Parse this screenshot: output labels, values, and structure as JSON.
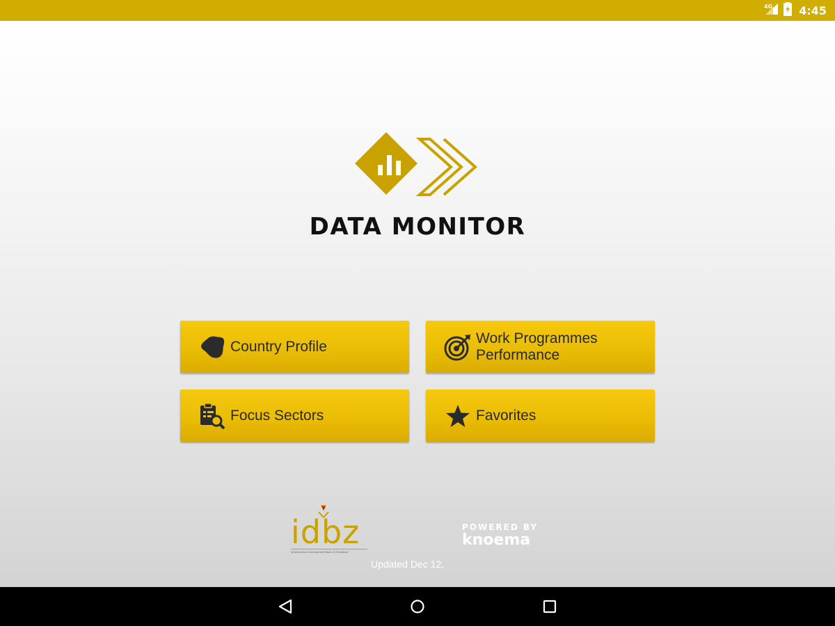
{
  "status_bar": {
    "network": "4G",
    "time": "4:45"
  },
  "app": {
    "title": "DATA MONITOR"
  },
  "menu": [
    {
      "label": "Country Profile",
      "icon": "zimbabwe-map-icon"
    },
    {
      "label": "Work Programmes Performance",
      "icon": "target-icon"
    },
    {
      "label": "Focus Sectors",
      "icon": "clipboard-search-icon"
    },
    {
      "label": "Favorites",
      "icon": "star-icon"
    }
  ],
  "footer": {
    "idbz_text": "idbz",
    "idbz_subtitle": "Infrastructure Development Bank of Zimbabwe",
    "powered_by": "POWERED BY",
    "powered_name": "knoema",
    "updated": "Updated Dec 12,"
  },
  "colors": {
    "status_bar": "#d1ad00",
    "button": "#f2c30c",
    "brand_gold": "#c9a200"
  },
  "nav": {
    "back_icon": "back-triangle-icon",
    "home_icon": "home-circle-icon",
    "recent_icon": "recents-square-icon"
  }
}
